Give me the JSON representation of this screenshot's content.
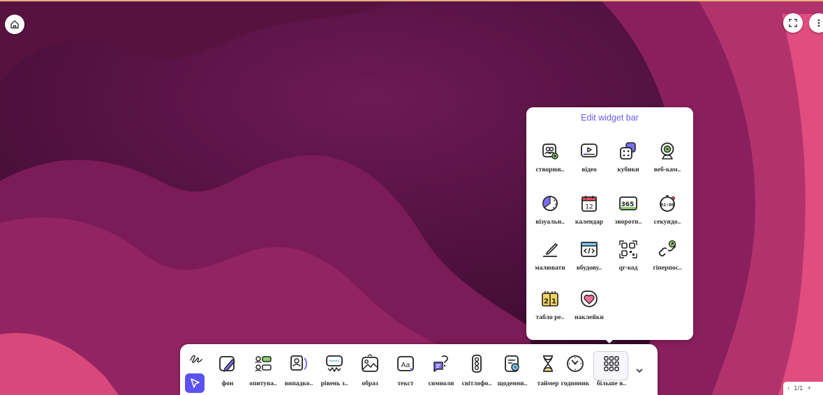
{
  "panel": {
    "title": "Edit widget bar",
    "items": [
      {
        "label": "створюв..",
        "icon": "group-maker-icon"
      },
      {
        "label": "відео",
        "icon": "video-icon"
      },
      {
        "label": "кубики",
        "icon": "dice-icon"
      },
      {
        "label": "веб-кам..",
        "icon": "webcam-icon"
      },
      {
        "label": "візуальн..",
        "icon": "visual-timer-icon"
      },
      {
        "label": "календар",
        "icon": "calendar-icon"
      },
      {
        "label": "зворотн..",
        "icon": "countdown-icon"
      },
      {
        "label": "секундо..",
        "icon": "stopwatch-icon"
      },
      {
        "label": "малювати",
        "icon": "draw-pen-icon"
      },
      {
        "label": "вбудову..",
        "icon": "embed-code-icon"
      },
      {
        "label": "qr-код",
        "icon": "qr-code-icon"
      },
      {
        "label": "гіперпос..",
        "icon": "hyperlink-icon"
      },
      {
        "label": "табло ре..",
        "icon": "scoreboard-icon"
      },
      {
        "label": "наклейки",
        "icon": "sticker-heart-icon"
      }
    ]
  },
  "toolbar": {
    "tools": [
      {
        "label": "фон",
        "icon": "background-pen-icon"
      },
      {
        "label": "опитува..",
        "icon": "poll-icon"
      },
      {
        "label": "випадко..",
        "icon": "random-picker-icon"
      },
      {
        "label": "рівень з..",
        "icon": "noise-level-icon"
      },
      {
        "label": "образ",
        "icon": "image-icon"
      },
      {
        "label": "текст",
        "icon": "text-icon"
      },
      {
        "label": "символи",
        "icon": "symbols-icon"
      },
      {
        "label": "світлофо..",
        "icon": "traffic-light-icon"
      },
      {
        "label": "щоденни..",
        "icon": "daily-schedule-icon"
      },
      {
        "label": "таймер",
        "icon": "hourglass-icon"
      },
      {
        "label": "годинник",
        "icon": "clock-icon"
      },
      {
        "label": "більше в..",
        "icon": "more-grid-icon"
      }
    ]
  },
  "pager": {
    "text": "1/1"
  },
  "colors": {
    "accent": "#5b52f0",
    "bg_dark": "#4a0e3b",
    "wave_mid": "#8a1f5e",
    "wave_pink": "#e04d7e"
  }
}
